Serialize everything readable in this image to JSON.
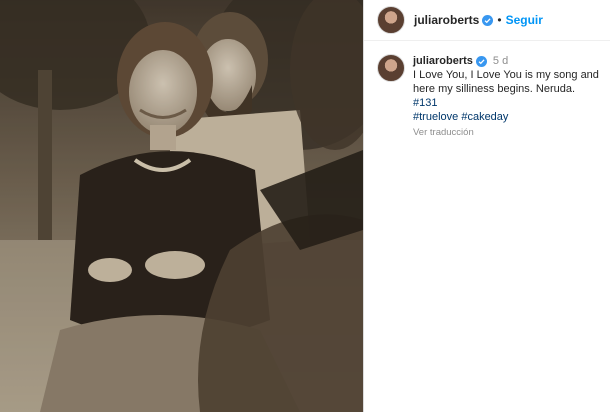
{
  "post": {
    "photo_alt": "",
    "header": {
      "username": "juliaroberts",
      "separator": "•",
      "follow_label": "Seguir"
    },
    "caption": {
      "username": "juliaroberts",
      "time_ago": "5 d",
      "text": "I Love You, I Love You is my song and here my silliness begins. Neruda.",
      "hashtags": [
        "#131",
        "#truelove",
        "#cakeday"
      ],
      "translate_label": "Ver traducción"
    }
  },
  "colors": {
    "link_blue": "#0095f6",
    "hashtag": "#00376b",
    "verified_badge": "#3897f0"
  }
}
